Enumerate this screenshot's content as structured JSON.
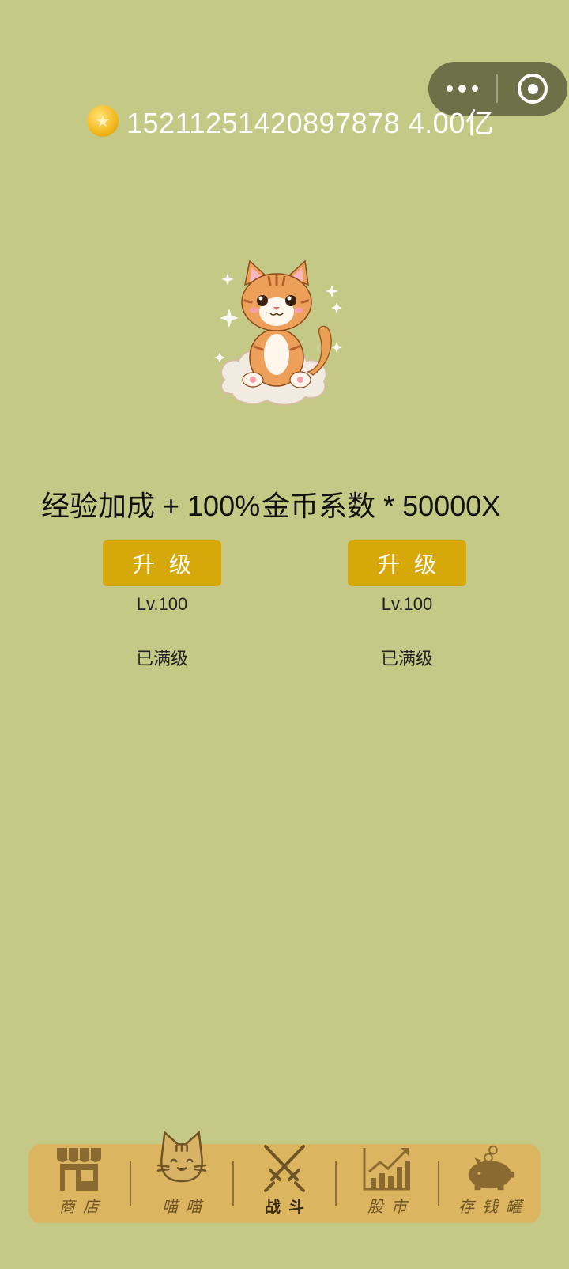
{
  "menu_capsule": {
    "more_icon": "more-dots-icon",
    "close_icon": "target-circle-icon"
  },
  "header": {
    "coin_icon": "gold-coin-icon",
    "coin_amount": "15211251420897878 4.00亿"
  },
  "stats": {
    "exp_bonus": "经验加成 + 100%",
    "coin_factor": "金币系数 * 50000X"
  },
  "upgrades": [
    {
      "button": "升级",
      "level": "Lv.100",
      "status": "已满级"
    },
    {
      "button": "升级",
      "level": "Lv.100",
      "status": "已满级"
    }
  ],
  "tabs": [
    {
      "label": "商店",
      "icon": "shop-icon"
    },
    {
      "label": "喵喵",
      "icon": "cat-face-icon"
    },
    {
      "label": "战斗",
      "icon": "crossed-swords-icon",
      "active": true
    },
    {
      "label": "股市",
      "icon": "stock-chart-icon"
    },
    {
      "label": "存钱罐",
      "icon": "piggy-bank-icon"
    }
  ],
  "colors": {
    "background": "#c5c986",
    "button": "#d6a80a",
    "tabbar": "#dcb560",
    "tab_text": "#6e5426"
  }
}
